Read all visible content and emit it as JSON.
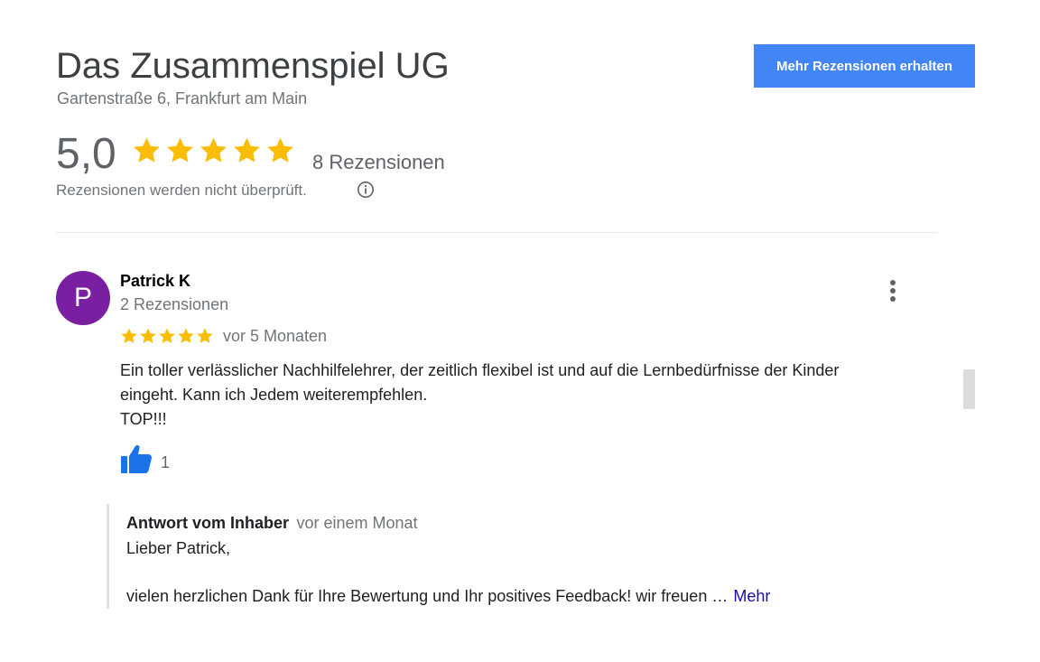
{
  "business": {
    "name": "Das Zusammenspiel UG",
    "address": "Gartenstraße 6, Frankfurt am Main",
    "more_reviews_button": "Mehr Rezensionen erhalten",
    "rating": "5,0",
    "rating_stars": 5,
    "review_count": "8 Rezensionen",
    "not_verified": "Rezensionen werden nicht überprüft.",
    "info_icon": "info-icon"
  },
  "review": {
    "avatar_letter": "P",
    "avatar_color": "#7b1fa2",
    "author": "Patrick K",
    "author_reviews": "2 Rezensionen",
    "stars": 5,
    "date": "vor 5 Monaten",
    "text_lines": [
      "Ein toller verlässlicher Nachhilfelehrer, der zeitlich flexibel ist und auf die Lernbedürfnisse der Kinder",
      "eingeht. Kann ich Jedem weiterempfehlen.",
      "TOP!!!"
    ],
    "likes": "1",
    "like_icon": "thumbs-up-icon",
    "more_icon": "more-vert-icon"
  },
  "reply": {
    "author": "Antwort vom Inhaber",
    "date": "vor einem Monat",
    "line1": "Lieber Patrick,",
    "line2": "vielen herzlichen Dank für Ihre Bewertung und Ihr positives Feedback! wir freuen …",
    "more_link": "Mehr"
  },
  "colors": {
    "star": "#fbbc04",
    "button": "#4285f4",
    "link": "#1a0dab",
    "like": "#1a73e8"
  }
}
